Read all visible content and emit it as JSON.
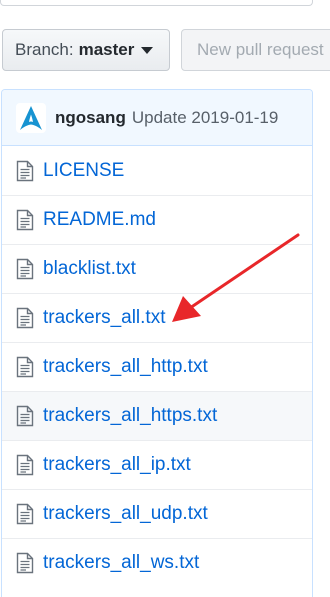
{
  "branch": {
    "label": "Branch:",
    "value": "master"
  },
  "pull_request": {
    "label": "New pull request"
  },
  "commit": {
    "author": "ngosang",
    "message": "Update 2019-01-19"
  },
  "files": [
    {
      "name": "LICENSE"
    },
    {
      "name": "README.md"
    },
    {
      "name": "blacklist.txt"
    },
    {
      "name": "trackers_all.txt"
    },
    {
      "name": "trackers_all_http.txt"
    },
    {
      "name": "trackers_all_https.txt"
    },
    {
      "name": "trackers_all_ip.txt"
    },
    {
      "name": "trackers_all_udp.txt"
    },
    {
      "name": "trackers_all_ws.txt"
    }
  ],
  "colors": {
    "link": "#0366d6",
    "annotation_arrow": "#e8272a",
    "commit_bar": "#f1f8ff",
    "avatar_logo": "#1793d1"
  },
  "icons": {
    "file": "file-text-icon",
    "avatar": "arch-linux-logo-icon",
    "caret": "caret-down-icon"
  }
}
